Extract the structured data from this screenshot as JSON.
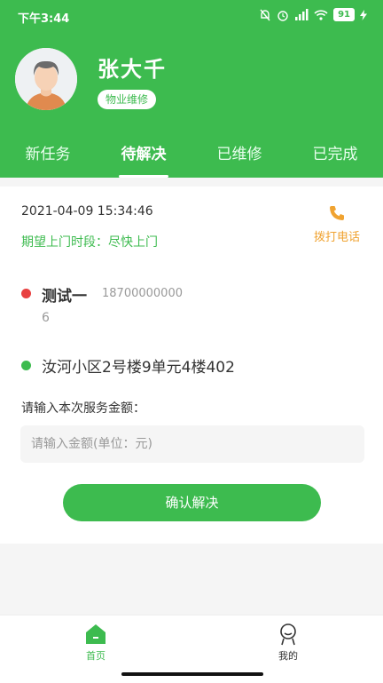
{
  "status_bar": {
    "time": "下午3:44",
    "battery": "91"
  },
  "profile": {
    "name": "张大千",
    "role": "物业维修"
  },
  "tabs": [
    {
      "label": "新任务",
      "active": false
    },
    {
      "label": "待解决",
      "active": true
    },
    {
      "label": "已维修",
      "active": false
    },
    {
      "label": "已完成",
      "active": false
    }
  ],
  "order": {
    "datetime": "2021-04-09 15:34:46",
    "expected_visit": "期望上门时段：尽快上门",
    "call_label": "拨打电话",
    "customer_name": "测试一",
    "customer_phone": "18700000000",
    "note": "6",
    "address": "汝河小区2号楼9单元4楼402",
    "amount_label": "请输入本次服务金额：",
    "amount_placeholder": "请输入金额(单位：元)",
    "amount_value": "",
    "confirm_label": "确认解决"
  },
  "bottom_nav": [
    {
      "label": "首页",
      "active": true,
      "icon": "home-icon"
    },
    {
      "label": "我的",
      "active": false,
      "icon": "profile-icon"
    }
  ],
  "colors": {
    "primary": "#3dbb4f",
    "call": "#f0a331",
    "dot_red": "#e84040"
  }
}
